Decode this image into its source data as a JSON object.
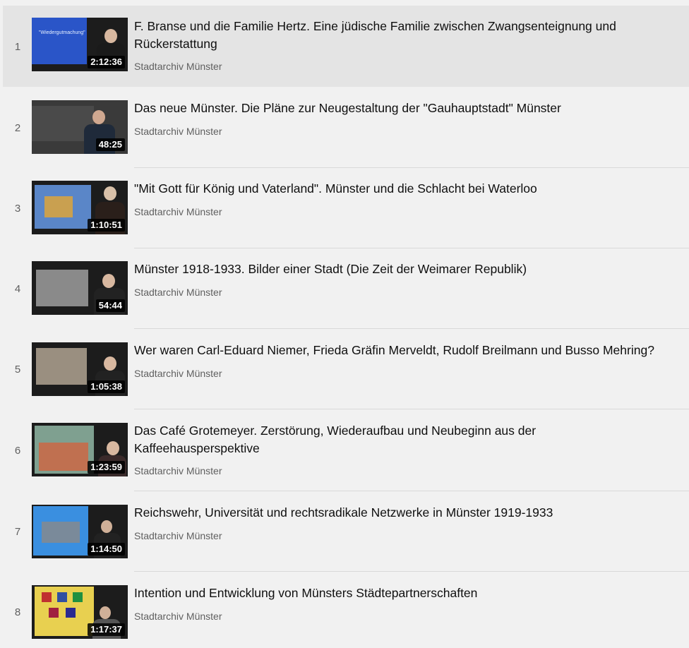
{
  "items": [
    {
      "index": "1",
      "title": "F. Branse und die Familie Hertz. Eine jüdische Familie zwischen Zwangsenteignung und Rückerstattung",
      "channel": "Stadtarchiv Münster",
      "duration": "2:12:36",
      "slide_text": "\"Wiedergutmachung\""
    },
    {
      "index": "2",
      "title": "Das neue Münster. Die Pläne zur Neugestaltung der \"Gauhauptstadt\" Münster",
      "channel": "Stadtarchiv Münster",
      "duration": "48:25"
    },
    {
      "index": "3",
      "title": "\"Mit Gott für König und Vaterland\". Münster und die Schlacht bei Waterloo",
      "channel": "Stadtarchiv Münster",
      "duration": "1:10:51"
    },
    {
      "index": "4",
      "title": "Münster 1918-1933. Bilder einer Stadt (Die Zeit der Weimarer Republik)",
      "channel": "Stadtarchiv Münster",
      "duration": "54:44"
    },
    {
      "index": "5",
      "title": "Wer waren Carl-Eduard Niemer, Frieda Gräfin Merveldt, Rudolf Breilmann und Busso Mehring?",
      "channel": "Stadtarchiv Münster",
      "duration": "1:05:38"
    },
    {
      "index": "6",
      "title": "Das Café Grotemeyer. Zerstörung, Wiederaufbau und Neubeginn aus der Kaffeehausperspektive",
      "channel": "Stadtarchiv Münster",
      "duration": "1:23:59"
    },
    {
      "index": "7",
      "title": "Reichswehr, Universität und rechtsradikale Netzwerke in Münster 1919-1933",
      "channel": "Stadtarchiv Münster",
      "duration": "1:14:50"
    },
    {
      "index": "8",
      "title": "Intention und Entwicklung von Münsters Städtepartnerschaften",
      "channel": "Stadtarchiv Münster",
      "duration": "1:17:37"
    }
  ],
  "active_index": 0,
  "colors": {
    "background": "#f1f1f1",
    "active_row": "#e4e4e4",
    "title": "#0f0f0f",
    "secondary": "#606060"
  }
}
